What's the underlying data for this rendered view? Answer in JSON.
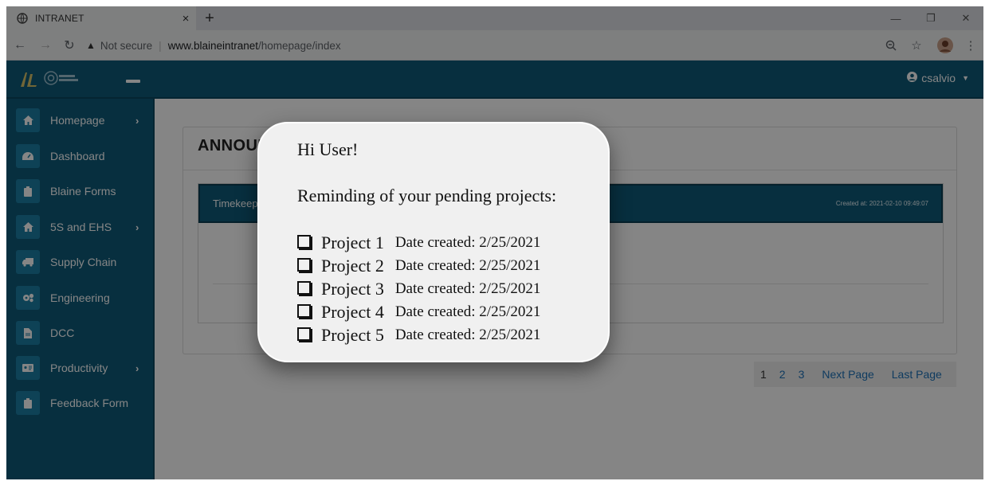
{
  "browser": {
    "tab_title": "INTRANET",
    "tab_close": "×",
    "new_tab": "+",
    "not_secure": "Not secure",
    "url_domain": "www.blaineintranet",
    "url_path": "/homepage/index"
  },
  "app": {
    "user": "csalvio",
    "sidebar": [
      {
        "label": "Homepage",
        "icon": "home-icon",
        "has_children": true
      },
      {
        "label": "Dashboard",
        "icon": "dashboard-icon",
        "has_children": false
      },
      {
        "label": "Blaine Forms",
        "icon": "clipboard-icon",
        "has_children": false
      },
      {
        "label": "5S and EHS",
        "icon": "home-icon",
        "has_children": true
      },
      {
        "label": "Supply Chain",
        "icon": "truck-icon",
        "has_children": false
      },
      {
        "label": "Engineering",
        "icon": "cogs-icon",
        "has_children": false
      },
      {
        "label": "DCC",
        "icon": "file-icon",
        "has_children": false
      },
      {
        "label": "Productivity",
        "icon": "id-card-icon",
        "has_children": true
      },
      {
        "label": "Feedback Form",
        "icon": "clipboard-icon",
        "has_children": false
      }
    ],
    "announcement_heading": "ANNOUNCEMENTS",
    "announcement": {
      "title": "Timekeeping",
      "created": "Created at: 2021-02-10 09:49:07"
    },
    "pagination": [
      "1",
      "2",
      "3",
      "Next Page",
      "Last Page"
    ]
  },
  "modal": {
    "greeting": "Hi User!",
    "reminder": "Reminding of your pending projects:",
    "projects": [
      {
        "name": "Project 1",
        "date": "Date created: 2/25/2021"
      },
      {
        "name": "Project 2",
        "date": "Date created: 2/25/2021"
      },
      {
        "name": "Project 3",
        "date": "Date created: 2/25/2021"
      },
      {
        "name": "Project 4",
        "date": "Date created: 2/25/2021"
      },
      {
        "name": "Project 5",
        "date": "Date created: 2/25/2021"
      }
    ]
  }
}
